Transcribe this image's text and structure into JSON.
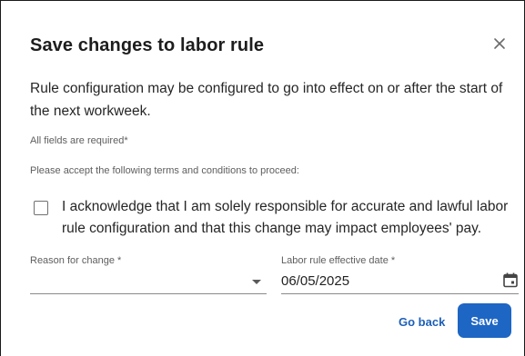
{
  "dialog": {
    "title": "Save changes to labor rule",
    "close_icon": "close-icon",
    "description": "Rule configuration may be configured to go into effect on or after the start of the next workweek.",
    "required_note": "All fields are required*",
    "terms_note": "Please accept the following terms and conditions to proceed:",
    "acknowledgement": {
      "checked": false,
      "label": "I acknowledge that I am solely responsible for accurate and lawful labor rule configuration and that this change may impact employees' pay."
    },
    "reason_field": {
      "label": "Reason for change *",
      "value": "",
      "icon": "dropdown-arrow-icon"
    },
    "date_field": {
      "label": "Labor rule effective date *",
      "value": "06/05/2025",
      "icon": "calendar-icon"
    },
    "buttons": {
      "go_back": "Go back",
      "save": "Save"
    },
    "colors": {
      "accent": "#1d66c4",
      "link": "#1d5fb8"
    }
  }
}
